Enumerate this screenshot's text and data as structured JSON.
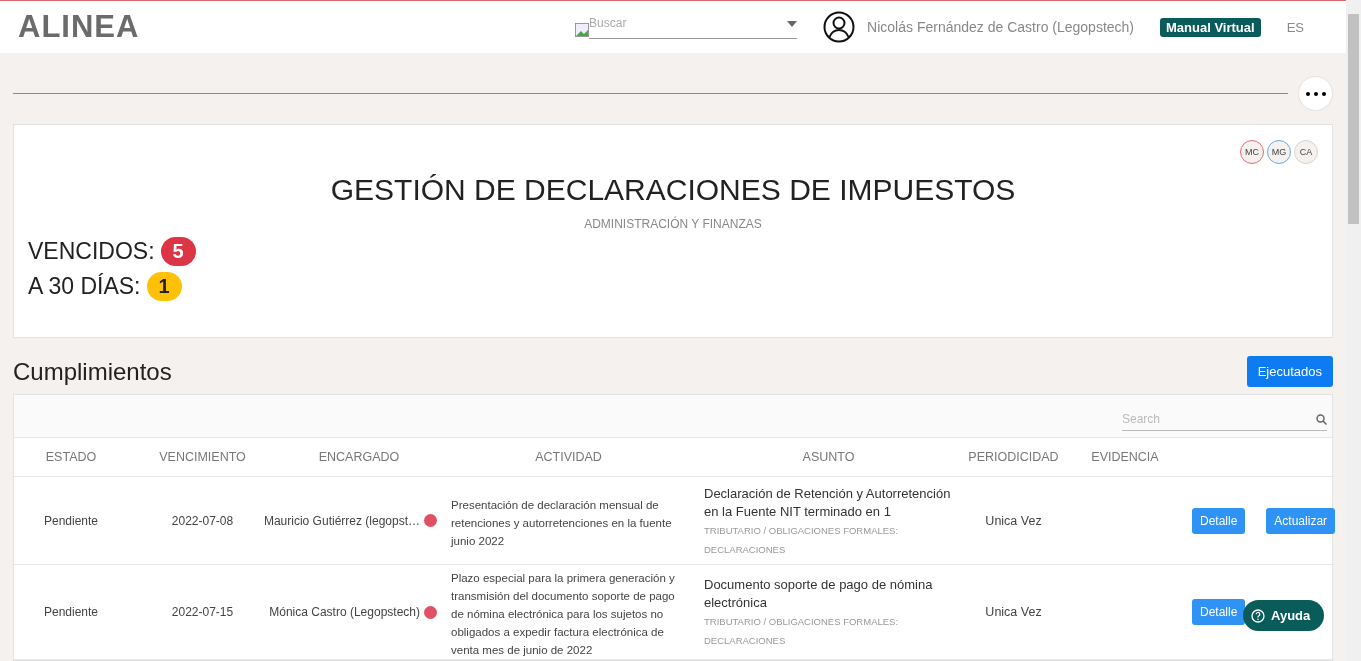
{
  "header": {
    "logo": "ALINEA",
    "search": {
      "placeholder": "Buscar"
    },
    "user": "Nicolás Fernández de Castro (Legopstech)",
    "manual_button": "Manual Virtual",
    "language": "ES"
  },
  "card": {
    "avatars": [
      {
        "initials": "MC",
        "color": "#e0707a"
      },
      {
        "initials": "MG",
        "color": "#6aa8e0"
      },
      {
        "initials": "CA",
        "color": "#d8d4d0"
      }
    ],
    "title": "GESTIÓN DE DECLARACIONES DE IMPUESTOS",
    "subtitle": "ADMINISTRACIÓN Y FINANZAS",
    "counters": [
      {
        "label": "VENCIDOS:",
        "count": "5",
        "color": "#dc3545"
      },
      {
        "label": "A 30 DÍAS:",
        "count": "1",
        "color": "#ffc107"
      }
    ]
  },
  "section": {
    "title": "Cumplimientos",
    "button": "Ejecutados"
  },
  "table": {
    "search": {
      "placeholder": "Search"
    },
    "columns": [
      "ESTADO",
      "VENCIMIENTO",
      "ENCARGADO",
      "ACTIVIDAD",
      "ASUNTO",
      "PERIODICIDAD",
      "EVIDENCIA"
    ],
    "rows": [
      {
        "estado": "Pendiente",
        "vencimiento": "2022-07-08",
        "encargado": "Mauricio Gutiérrez (legopst…",
        "color": "#e05064",
        "actividad": "Presentación de declaración mensual de retenciones y autorretenciones en la fuente junio 2022",
        "asunto": "Declaración de Retención y Autorretención en la Fuente NIT terminado en 1",
        "categoria": "TRIBUTARIO / OBLIGACIONES FORMALES: DECLARACIONES",
        "periodicidad": "Unica Vez",
        "actions": [
          "Detalle",
          "Actualizar"
        ]
      },
      {
        "estado": "Pendiente",
        "vencimiento": "2022-07-15",
        "encargado": "Mónica Castro (Legopstech)",
        "color": "#e05064",
        "actividad": "Plazo especial para la primera generación y transmisión del documento soporte de pago de nómina electrónica para los sujetos no obligados a expedir factura electrónica de venta mes de junio de 2022",
        "asunto": "Documento soporte de pago de nómina electrónica",
        "categoria": "TRIBUTARIO / OBLIGACIONES FORMALES: DECLARACIONES",
        "periodicidad": "Unica Vez",
        "actions": [
          "Detalle"
        ]
      }
    ]
  },
  "help_button": "Ayuda"
}
